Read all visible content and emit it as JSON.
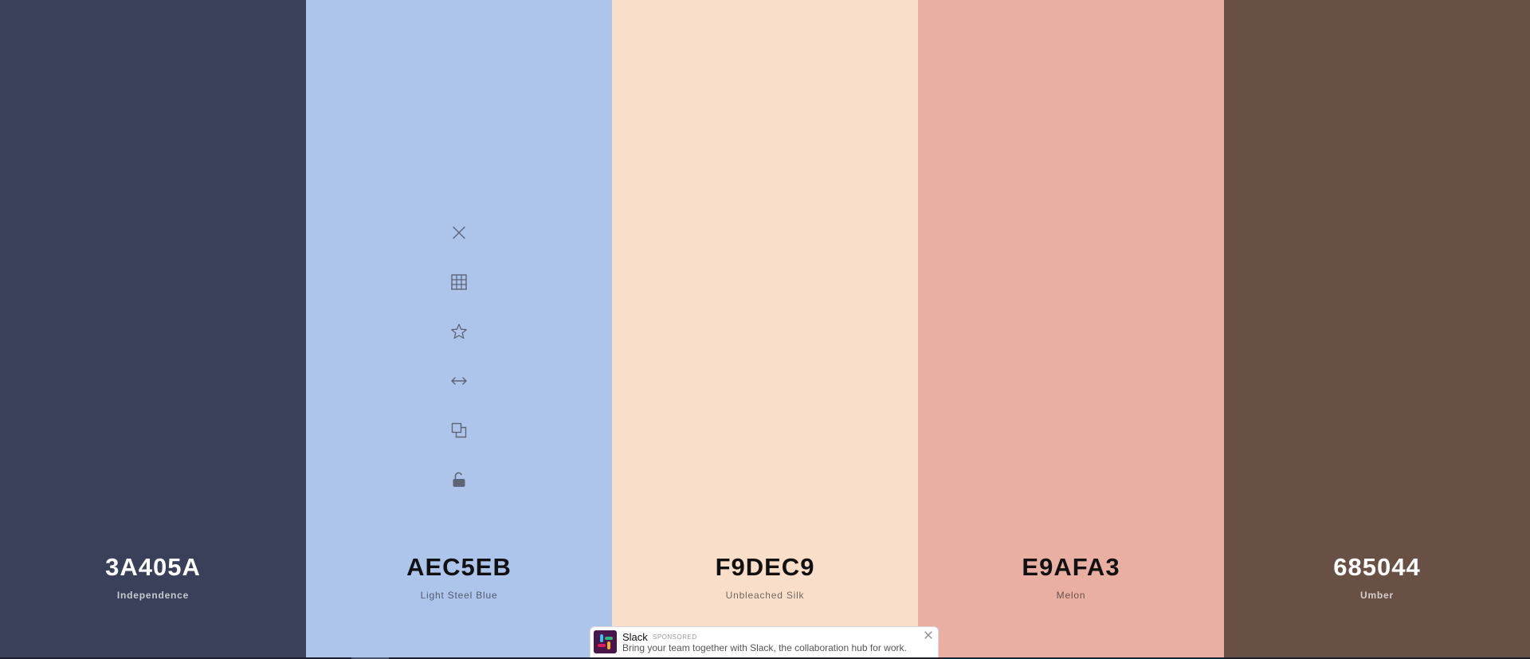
{
  "palette": {
    "swatches": [
      {
        "hex": "3A405A",
        "name": "Independence",
        "color": "#3A405A",
        "tone": "dark"
      },
      {
        "hex": "AEC5EB",
        "name": "Light Steel Blue",
        "color": "#AEC5EB",
        "tone": "light"
      },
      {
        "hex": "F9DEC9",
        "name": "Unbleached Silk",
        "color": "#F9DEC9",
        "tone": "light"
      },
      {
        "hex": "E9AFA3",
        "name": "Melon",
        "color": "#E9AFA3",
        "tone": "light"
      },
      {
        "hex": "685044",
        "name": "Umber",
        "color": "#685044",
        "tone": "dark"
      }
    ],
    "hovered_swatch_index": 1,
    "toolbar_icons": [
      "close-icon",
      "grid-icon",
      "star-icon",
      "drag-arrows-icon",
      "copy-icon",
      "unlock-icon"
    ],
    "icon_color": "#5d6475"
  },
  "ad": {
    "title": "Slack",
    "badge": "SPONSORED",
    "text": "Bring your team together with Slack, the collaboration hub for work.",
    "logo_icon": "slack-logo-icon",
    "close_icon": "close-icon"
  }
}
